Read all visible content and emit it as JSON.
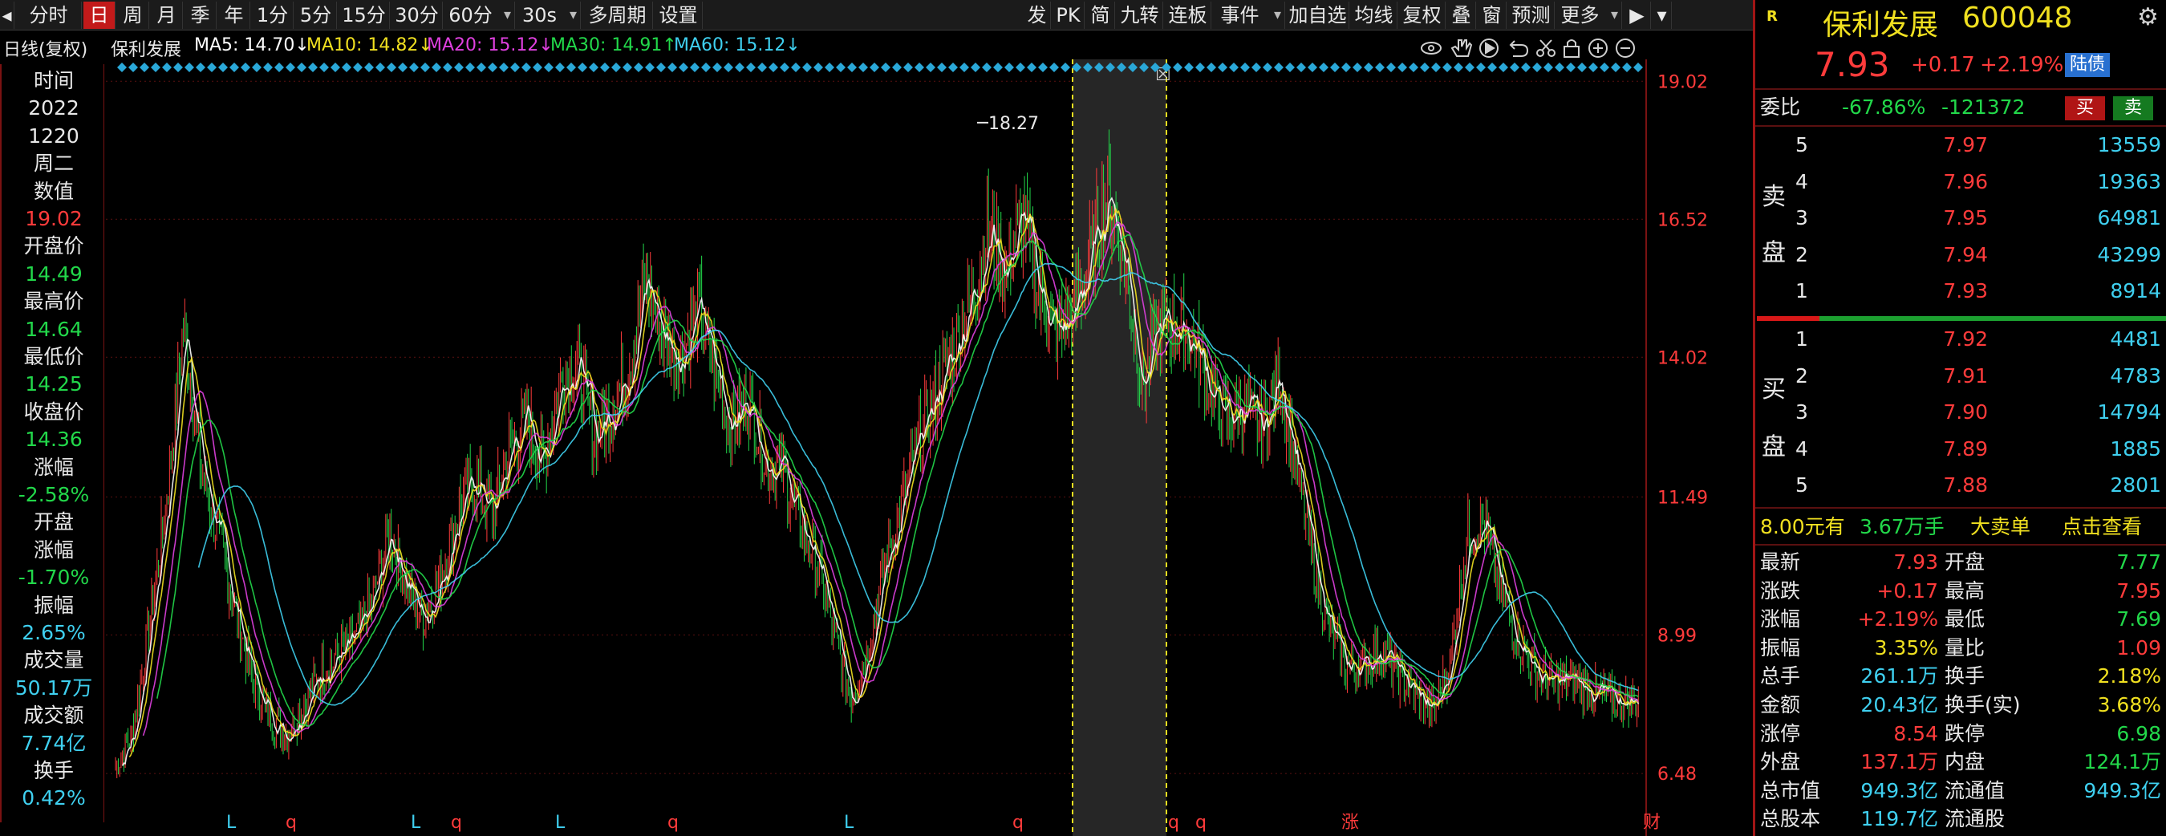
{
  "colors": {
    "up": "#ff3b3b",
    "down": "#22d84a",
    "ma5": "#ffffff",
    "ma10": "#f0e020",
    "ma20": "#e040e0",
    "ma30": "#22d84a",
    "ma60": "#3fd0f0",
    "grid": "#5a1010",
    "axis_label": "#ff3b3b"
  },
  "toolbar": {
    "items": [
      "分时",
      "日",
      "周",
      "月",
      "季",
      "年",
      "1分",
      "5分",
      "15分",
      "30分",
      "60分",
      "30s",
      "多周期",
      "设置"
    ],
    "active": "日",
    "right_items": [
      "发",
      "PK",
      "简",
      "九转",
      "连板",
      "事件",
      "加自选",
      "均线",
      "复权",
      "叠",
      "窗",
      "预测",
      "更多"
    ]
  },
  "chart_header": {
    "period_label": "日线(复权)",
    "stock_name": "保利发展",
    "ma5": "MA5: 14.70↓",
    "ma10": "MA10: 14.82↓",
    "ma20": "MA20: 15.12↓",
    "ma30": "MA30: 14.91↑",
    "ma60": "MA60: 15.12↓",
    "icons": [
      "eye-icon",
      "hand-icon",
      "play-icon",
      "undo-icon",
      "scissors-icon",
      "lock-icon",
      "zoom-in-icon",
      "zoom-out-icon"
    ]
  },
  "data_panel": {
    "rows": [
      {
        "text": "时间",
        "color": "white"
      },
      {
        "text": "2022",
        "color": "white"
      },
      {
        "text": "1220",
        "color": "white"
      },
      {
        "text": "周二",
        "color": "white"
      },
      {
        "text": "数值",
        "color": "white"
      },
      {
        "text": "19.02",
        "color": "red"
      },
      {
        "text": "开盘价",
        "color": "white"
      },
      {
        "text": "14.49",
        "color": "green"
      },
      {
        "text": "最高价",
        "color": "white"
      },
      {
        "text": "14.64",
        "color": "green"
      },
      {
        "text": "最低价",
        "color": "white"
      },
      {
        "text": "14.25",
        "color": "green"
      },
      {
        "text": "收盘价",
        "color": "white"
      },
      {
        "text": "14.36",
        "color": "green"
      },
      {
        "text": "涨幅",
        "color": "white"
      },
      {
        "text": "-2.58%",
        "color": "green"
      },
      {
        "text": "开盘",
        "color": "white"
      },
      {
        "text": "涨幅",
        "color": "white"
      },
      {
        "text": "-1.70%",
        "color": "green"
      },
      {
        "text": "振幅",
        "color": "white"
      },
      {
        "text": "2.65%",
        "color": "cyan"
      },
      {
        "text": "成交量",
        "color": "white"
      },
      {
        "text": "50.17万",
        "color": "cyan"
      },
      {
        "text": "成交额",
        "color": "white"
      },
      {
        "text": "7.74亿",
        "color": "cyan"
      },
      {
        "text": "换手",
        "color": "white"
      },
      {
        "text": "0.42%",
        "color": "cyan"
      }
    ]
  },
  "chart_data": {
    "type": "candlestick",
    "title": "保利发展",
    "ylim": [
      5.9,
      19.3
    ],
    "yticks": [
      "19.02",
      "16.52",
      "14.02",
      "11.49",
      "8.99",
      "6.48"
    ],
    "ytick_values": [
      19.02,
      16.52,
      14.02,
      11.49,
      8.99,
      6.48
    ],
    "peak_annotation": "18.27",
    "close_path": [
      6.6,
      7.2,
      9.2,
      11.5,
      14.6,
      12.0,
      10.8,
      9.4,
      8.2,
      7.5,
      7.2,
      7.7,
      8.3,
      8.6,
      8.9,
      9.6,
      10.8,
      9.9,
      9.3,
      10.0,
      11.2,
      11.8,
      11.2,
      12.3,
      12.9,
      12.1,
      13.6,
      13.9,
      12.6,
      13.1,
      13.9,
      15.4,
      14.4,
      14.0,
      14.9,
      13.8,
      12.8,
      13.3,
      12.1,
      12.0,
      11.0,
      10.3,
      9.0,
      7.8,
      8.8,
      10.3,
      11.4,
      12.6,
      13.4,
      14.2,
      15.1,
      16.3,
      15.6,
      16.6,
      15.2,
      14.4,
      14.8,
      15.9,
      17.0,
      15.7,
      13.5,
      14.6,
      14.6,
      14.3,
      13.4,
      12.9,
      13.1,
      12.7,
      13.7,
      12.0,
      10.3,
      9.0,
      8.4,
      8.5,
      8.7,
      8.3,
      7.9,
      7.6,
      8.5,
      10.8,
      11.0,
      9.7,
      8.9,
      8.3,
      8.1,
      8.2,
      8.0,
      7.9,
      7.8,
      7.8
    ],
    "x_markers": [
      "q",
      "L",
      "q",
      "L",
      "q",
      "L",
      "q",
      "L",
      "q",
      "q",
      "q",
      "涨",
      "财"
    ],
    "series": [
      {
        "name": "MA5",
        "value": 14.7
      },
      {
        "name": "MA10",
        "value": 14.82
      },
      {
        "name": "MA20",
        "value": 15.12
      },
      {
        "name": "MA30",
        "value": 14.91
      },
      {
        "name": "MA60",
        "value": 15.12
      }
    ],
    "crosshair_date": "2022-12-20"
  },
  "quote_panel": {
    "badge": "R",
    "name": "保利发展",
    "code": "600048",
    "price": "7.93",
    "change": "+0.17",
    "change_pct": "+2.19%",
    "tag": "陆债",
    "weibi_label": "委比",
    "weibi_pct": "-67.86%",
    "weibi_vol": "-121372",
    "buy_btn": "买",
    "sell_btn": "卖",
    "sell_label": [
      "卖",
      "盘"
    ],
    "buy_label": [
      "买",
      "盘"
    ],
    "asks": [
      {
        "level": "5",
        "price": "7.97",
        "volume": "13559"
      },
      {
        "level": "4",
        "price": "7.96",
        "volume": "19363"
      },
      {
        "level": "3",
        "price": "7.95",
        "volume": "64981"
      },
      {
        "level": "2",
        "price": "7.94",
        "volume": "43299"
      },
      {
        "level": "1",
        "price": "7.93",
        "volume": "8914"
      }
    ],
    "bids": [
      {
        "level": "1",
        "price": "7.92",
        "volume": "4481"
      },
      {
        "level": "2",
        "price": "7.91",
        "volume": "4783"
      },
      {
        "level": "3",
        "price": "7.90",
        "volume": "14794"
      },
      {
        "level": "4",
        "price": "7.89",
        "volume": "1885"
      },
      {
        "level": "5",
        "price": "7.88",
        "volume": "2801"
      }
    ],
    "big_order": {
      "price_text": "8.00元有",
      "volume_text": "3.67万手",
      "label": "大卖单",
      "link": "点击查看"
    },
    "stats": [
      {
        "l": "最新",
        "lv": "7.93",
        "lc": "red",
        "r": "开盘",
        "rv": "7.77",
        "rc": "green"
      },
      {
        "l": "涨跌",
        "lv": "+0.17",
        "lc": "red",
        "r": "最高",
        "rv": "7.95",
        "rc": "red"
      },
      {
        "l": "涨幅",
        "lv": "+2.19%",
        "lc": "red",
        "r": "最低",
        "rv": "7.69",
        "rc": "green"
      },
      {
        "l": "振幅",
        "lv": "3.35%",
        "lc": "yellow",
        "r": "量比",
        "rv": "1.09",
        "rc": "red"
      },
      {
        "l": "总手",
        "lv": "261.1万",
        "lc": "cyan",
        "r": "换手",
        "rv": "2.18%",
        "rc": "yellow"
      },
      {
        "l": "金额",
        "lv": "20.43亿",
        "lc": "cyan",
        "r": "换手(实)",
        "rv": "3.68%",
        "rc": "yellow"
      },
      {
        "l": "涨停",
        "lv": "8.54",
        "lc": "red",
        "r": "跌停",
        "rv": "6.98",
        "rc": "green"
      },
      {
        "l": "外盘",
        "lv": "137.1万",
        "lc": "red",
        "r": "内盘",
        "rv": "124.1万",
        "rc": "green"
      },
      {
        "l": "总市值",
        "lv": "949.3亿",
        "lc": "cyan",
        "r": "流通值",
        "rv": "949.3亿",
        "rc": "cyan"
      },
      {
        "l": "总股本",
        "lv": "119.7亿",
        "lc": "cyan",
        "r": "流通股",
        "rv": "",
        "rc": "cyan"
      }
    ]
  }
}
